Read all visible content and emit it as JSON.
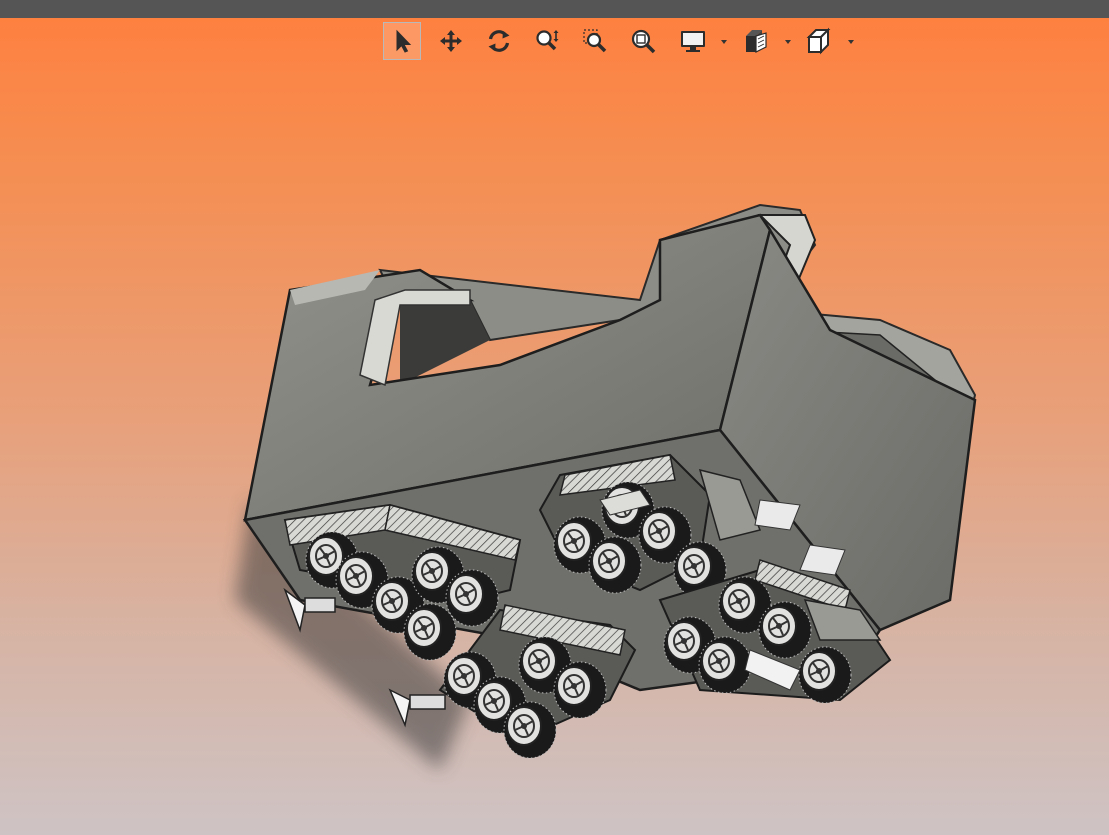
{
  "window": {
    "title": ""
  },
  "toolbar": {
    "tools": [
      {
        "id": "select",
        "icon": "arrow-pointer-icon",
        "active": true
      },
      {
        "id": "pan",
        "icon": "move-arrows-icon",
        "active": false
      },
      {
        "id": "rotate",
        "icon": "rotate-icon",
        "active": false
      },
      {
        "id": "zoom-dynamic",
        "icon": "zoom-dynamic-icon",
        "active": false
      },
      {
        "id": "zoom-window",
        "icon": "zoom-window-icon",
        "active": false
      },
      {
        "id": "zoom-fit",
        "icon": "zoom-fit-icon",
        "active": false
      },
      {
        "id": "display-mode",
        "icon": "monitor-icon",
        "has_dropdown": true
      },
      {
        "id": "section-view",
        "icon": "section-view-icon",
        "has_dropdown": true
      },
      {
        "id": "view-orientation",
        "icon": "cube-icon",
        "has_dropdown": true
      }
    ]
  },
  "viewport": {
    "background_top": "#ff7f3e",
    "background_bottom": "#cec3c4",
    "model_color": "#7d7d78"
  }
}
